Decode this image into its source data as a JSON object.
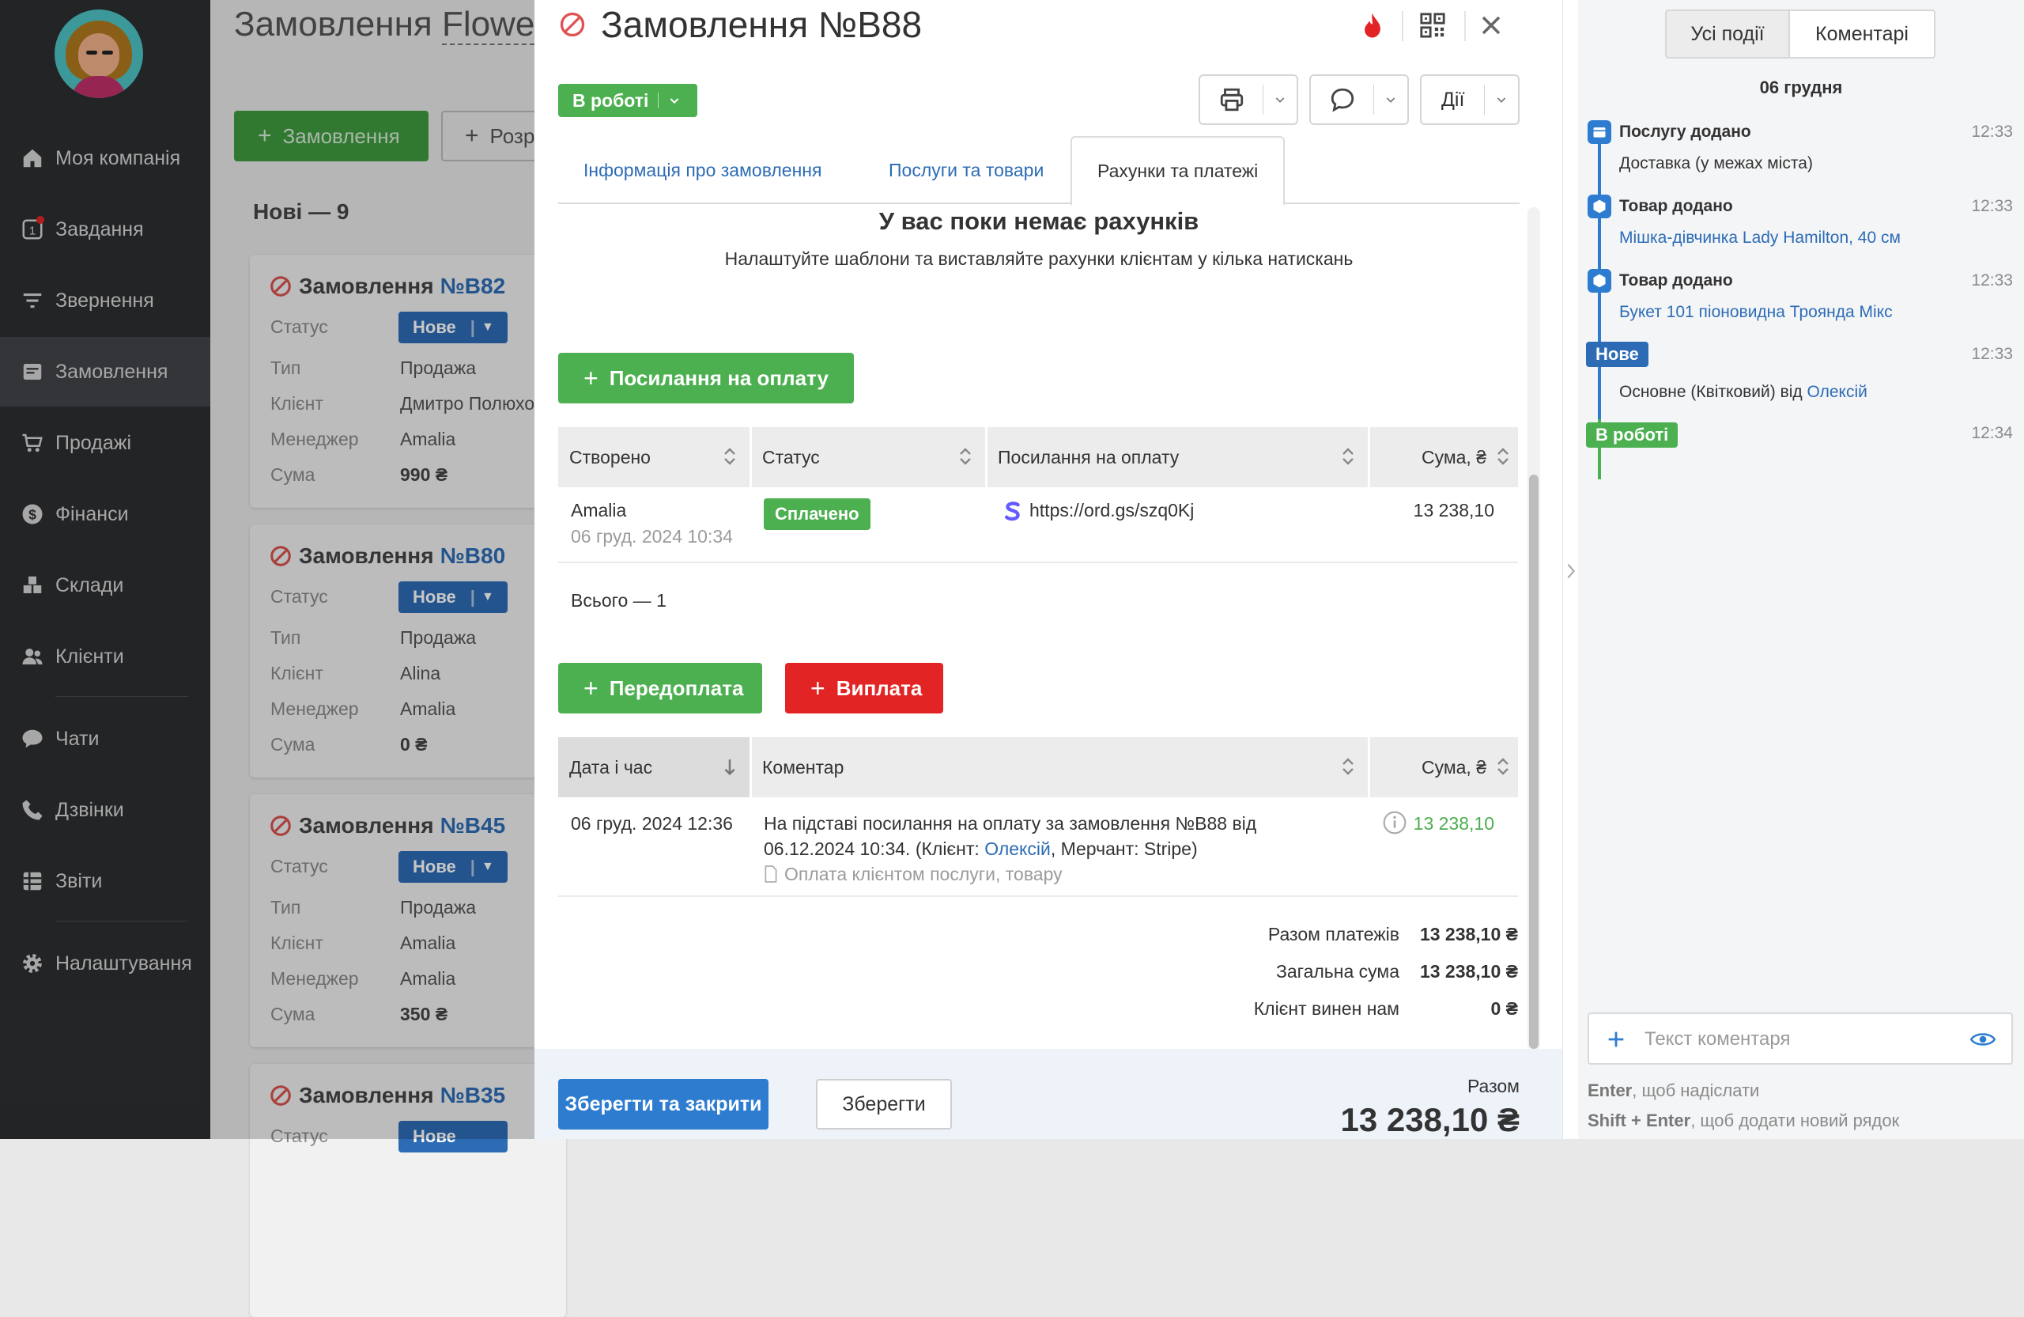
{
  "sidebar": {
    "items": [
      {
        "label": "Моя компанія",
        "icon": "home-icon"
      },
      {
        "label": "Завдання",
        "icon": "tasks-icon",
        "badge": "1"
      },
      {
        "label": "Звернення",
        "icon": "filter-icon"
      },
      {
        "label": "Замовлення",
        "icon": "orders-icon",
        "active": true
      },
      {
        "label": "Продажі",
        "icon": "cart-icon"
      },
      {
        "label": "Фінанси",
        "icon": "dollar-icon"
      },
      {
        "label": "Склади",
        "icon": "boxes-icon"
      },
      {
        "label": "Клієнти",
        "icon": "users-icon"
      },
      {
        "label": "Чати",
        "icon": "chat-icon"
      },
      {
        "label": "Дзвінки",
        "icon": "phone-icon"
      },
      {
        "label": "Звіти",
        "icon": "reports-icon"
      },
      {
        "label": "Налаштування",
        "icon": "gear-icon"
      }
    ]
  },
  "board": {
    "title_prefix": "Замовлення",
    "title_link": "Flowe",
    "add_order_label": "Замовлення",
    "second_btn_label": "Розр",
    "column_header": "Нові — 9",
    "cards": [
      {
        "title": "Замовлення",
        "num": "№B82",
        "status": "Нове",
        "type": "Продажа",
        "client": "Дмитро Полюхо",
        "manager": "Amalia",
        "sum": "990 ₴"
      },
      {
        "title": "Замовлення",
        "num": "№B80",
        "status": "Нове",
        "type": "Продажа",
        "client": "Alina",
        "manager": "Amalia",
        "sum": "0 ₴"
      },
      {
        "title": "Замовлення",
        "num": "№B45",
        "status": "Нове",
        "type": "Продажа",
        "client": "Amalia",
        "manager": "Amalia",
        "sum": "350 ₴"
      },
      {
        "title": "Замовлення",
        "num": "№B35",
        "status": "Нове"
      }
    ],
    "labels": {
      "status": "Статус",
      "type": "Тип",
      "client": "Клієнт",
      "manager": "Менеджер",
      "sum": "Сума"
    }
  },
  "modal": {
    "title": "Замовлення №B88",
    "status_label": "В роботі",
    "actions_label": "Дії",
    "tabs": [
      "Інформація про замовлення",
      "Послуги та товари",
      "Рахунки та платежі"
    ],
    "active_tab": 2,
    "empty_title": "У вас поки немає рахунків",
    "empty_subtitle": "Налаштуйте шаблони та виставляйте рахунки клієнтам у кілька натискань",
    "payment_link_btn": "Посилання на оплату",
    "links_table": {
      "headers": [
        "Створено",
        "Статус",
        "Посилання на оплату",
        "Сума, ₴"
      ],
      "rows": [
        {
          "created_by": "Amalia",
          "created_at": "06 груд. 2024 10:34",
          "status": "Сплачено",
          "link": "https://ord.gs/szq0Kj",
          "sum": "13 238,10"
        }
      ],
      "total": "Всього — 1"
    },
    "prepayment_btn": "Передоплата",
    "payout_btn": "Виплата",
    "payments_table": {
      "headers": [
        "Дата і час",
        "Коментар",
        "Сума, ₴"
      ],
      "rows": [
        {
          "datetime": "06 груд. 2024 12:36",
          "comment_line1": "На підставі посилання на оплату за замовлення №B88 від",
          "comment_line2_a": "06.12.2024 10:34.  (Клієнт: ",
          "comment_client": "Олексій",
          "comment_line2_b": ", Мерчант: Stripe)",
          "category": "Оплата клієнтом послуги, товару",
          "sum": "13 238,10"
        }
      ]
    },
    "totals": [
      {
        "label": "Разом платежів",
        "value": "13 238,10 ₴"
      },
      {
        "label": "Загальна сума",
        "value": "13 238,10 ₴"
      },
      {
        "label": "Клієнт винен нам",
        "value": "0 ₴"
      }
    ],
    "footer": {
      "save_close": "Зберегти та закрити",
      "save": "Зберегти",
      "total_label": "Разом",
      "total_value": "13 238,10 ₴"
    }
  },
  "events_panel": {
    "tabs": [
      "Усі події",
      "Коментарі"
    ],
    "date": "06 грудня",
    "events": [
      {
        "title": "Послугу додано",
        "time": "12:33",
        "detail": "Доставка (у межах міста)"
      },
      {
        "title": "Товар додано",
        "time": "12:33",
        "detail": "Мішка-дівчинка Lady Hamilton, 40 см"
      },
      {
        "title": "Товар додано",
        "time": "12:33",
        "detail": "Букет 101 піоновидна Троянда Мікс"
      },
      {
        "badge": "Нове",
        "time": "12:33",
        "detail_prefix": "Основне (Квітковий) від ",
        "detail_link": "Олексій"
      },
      {
        "badge": "В роботі",
        "time": "12:34"
      }
    ],
    "comment_placeholder": "Текст коментаря",
    "hint1_key": "Enter",
    "hint1_text": ", щоб надіслати",
    "hint2_key": "Shift + Enter",
    "hint2_text": ", щоб додати новий рядок"
  },
  "colors": {
    "green": "#4caf50",
    "blue": "#2d6cb5",
    "red": "#e32424",
    "sidebar": "#2e2f31"
  }
}
